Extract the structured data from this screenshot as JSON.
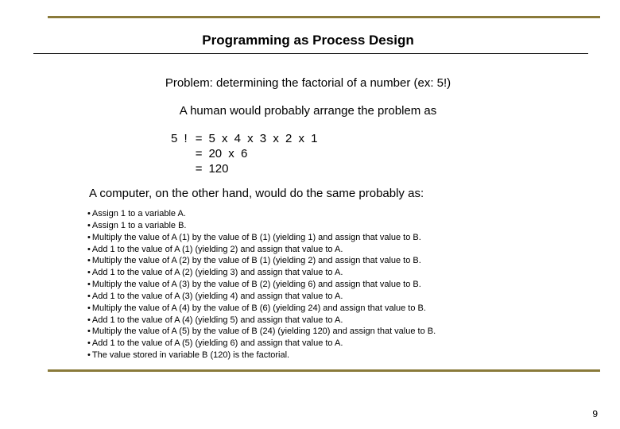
{
  "title": "Programming as Process Design",
  "problem": "Problem: determining the factorial of a number (ex: 5!)",
  "human": "A human would probably arrange the problem as",
  "equation": [
    {
      "left": "5 !",
      "eq": "=",
      "right": "5 x 4 x 3 x 2 x 1"
    },
    {
      "left": "",
      "eq": "=",
      "right": " 20 x 6"
    },
    {
      "left": "",
      "eq": "=",
      "right": "  120"
    }
  ],
  "computer": "A computer, on the other hand, would do the same probably as:",
  "steps": [
    "Assign 1 to a variable A.",
    "Assign 1 to a variable B.",
    "Multiply the value of A (1) by the value of B (1) (yielding 1) and assign that value to B.",
    "Add 1 to the value of A (1) (yielding 2) and assign that value to A.",
    "Multiply the value of A (2) by the value of B (1) (yielding 2) and assign that value to B.",
    "Add 1 to the value of A (2) (yielding 3) and assign that value to A.",
    "Multiply the value of A (3) by the value of B (2) (yielding 6) and assign that value to B.",
    "Add 1 to the value of A (3) (yielding 4) and assign that value to A.",
    "Multiply the value of A (4) by the value of B (6) (yielding 24) and assign that value to B.",
    "Add 1 to the value of A (4) (yielding 5) and assign that value to A.",
    "Multiply the value of A (5) by the value of B (24) (yielding 120) and assign that value to B.",
    "Add 1 to the value of A (5) (yielding 6) and assign that value to A.",
    "The value stored in variable B (120) is the factorial."
  ],
  "page_number": "9"
}
